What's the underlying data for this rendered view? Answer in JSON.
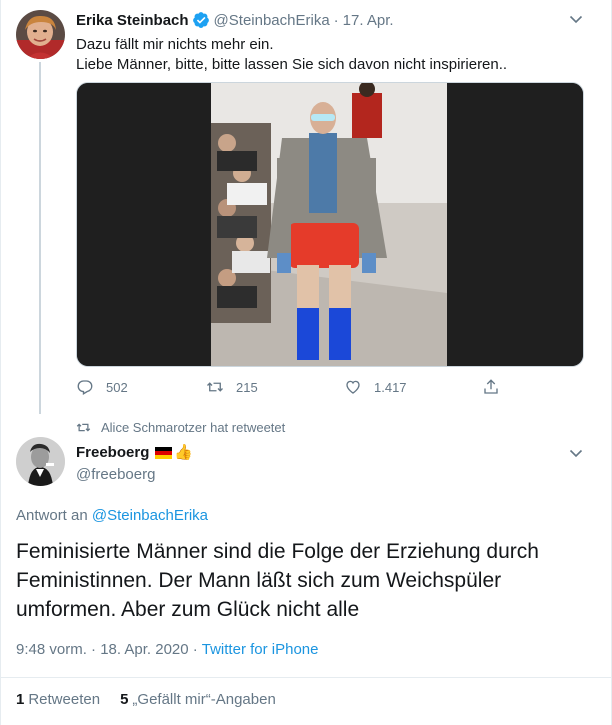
{
  "tweet1": {
    "name": "Erika Steinbach",
    "handle": "@SteinbachErika",
    "date": "17. Apr.",
    "line1": "Dazu fällt mir nichts mehr ein.",
    "line2": "Liebe Männer, bitte, bitte lassen Sie sich davon nicht inspirieren..",
    "replies": "502",
    "retweets": "215",
    "likes": "1.417"
  },
  "retweet_notice": "Alice Schmarotzer hat retweetet",
  "tweet2": {
    "name": "Freeboerg",
    "handle": "@freeboerg",
    "reply_prefix": "Antwort an",
    "reply_to": "@SteinbachErika",
    "text": "Feminisierte Männer sind die Folge der Erziehung durch Feministinnen. Der Mann läßt sich zum Weichspüler umformen. Aber zum Glück nicht alle",
    "time": "9:48 vorm. · 18. Apr. 2020 ·",
    "source": "Twitter for iPhone",
    "retweet_count": "1",
    "retweet_label": "Retweeten",
    "like_count": "5",
    "like_label": "„Gefällt mir“-Angaben"
  },
  "colors": {
    "link": "#1b95e0",
    "muted": "#657786",
    "verified": "#1da1f2"
  },
  "icons": [
    "verified-badge-icon",
    "chevron-down-icon",
    "reply-icon",
    "retweet-icon",
    "like-icon",
    "share-icon",
    "german-flag-icon",
    "thumbs-up-icon"
  ]
}
